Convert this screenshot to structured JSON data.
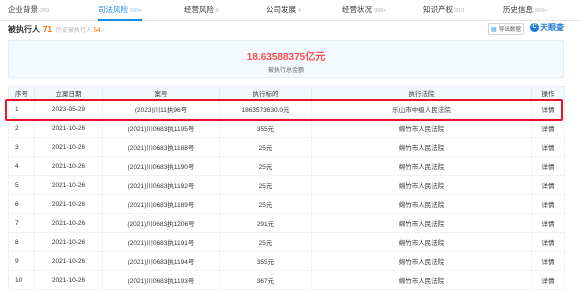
{
  "nav": {
    "tabs": [
      {
        "label": "企业背景",
        "count": "269",
        "active": false
      },
      {
        "label": "司法风险",
        "count": "999+",
        "active": true
      },
      {
        "label": "经营风险",
        "count": "6",
        "active": false
      },
      {
        "label": "公司发展",
        "count": "4",
        "active": false
      },
      {
        "label": "经营状况",
        "count": "999+",
        "active": false
      },
      {
        "label": "知识产权",
        "count": "319",
        "active": false
      },
      {
        "label": "历史信息",
        "count": "999+",
        "active": false
      }
    ]
  },
  "subbar": {
    "title": "被执行人",
    "count": "71",
    "history_label": "历史被执行人",
    "history_count": "54",
    "history_arrow": "›",
    "export_label": "导出数据",
    "logo_text": "天眼查",
    "logo_mark": "C"
  },
  "summary": {
    "amount": "18.63588375亿元",
    "label": "被执行总金额"
  },
  "table": {
    "headers": [
      "序号",
      "立案日期",
      "案号",
      "执行标的",
      "执行法院",
      "操作"
    ],
    "rows": [
      {
        "no": "1",
        "date": "2023-05-29",
        "case": "(2023)川11执96号",
        "amount": "1863573630.0元",
        "court": "乐山市中级人民法院",
        "action": "详情"
      },
      {
        "no": "2",
        "date": "2021-10-26",
        "case": "(2021)川0683执1195号",
        "amount": "355元",
        "court": "绵竹市人民法院",
        "action": "详情"
      },
      {
        "no": "3",
        "date": "2021-10-26",
        "case": "(2021)川0683执1188号",
        "amount": "25元",
        "court": "绵竹市人民法院",
        "action": "详情"
      },
      {
        "no": "4",
        "date": "2021-10-26",
        "case": "(2021)川0683执1190号",
        "amount": "25元",
        "court": "绵竹市人民法院",
        "action": "详情"
      },
      {
        "no": "5",
        "date": "2021-10-26",
        "case": "(2021)川0683执1192号",
        "amount": "25元",
        "court": "绵竹市人民法院",
        "action": "详情"
      },
      {
        "no": "6",
        "date": "2021-10-26",
        "case": "(2021)川0683执1189号",
        "amount": "25元",
        "court": "绵竹市人民法院",
        "action": "详情"
      },
      {
        "no": "7",
        "date": "2021-10-26",
        "case": "(2021)川0683执1206号",
        "amount": "291元",
        "court": "绵竹市人民法院",
        "action": "详情"
      },
      {
        "no": "8",
        "date": "2021-10-26",
        "case": "(2021)川0683执1191号",
        "amount": "25元",
        "court": "绵竹市人民法院",
        "action": "详情"
      },
      {
        "no": "9",
        "date": "2021-10-26",
        "case": "(2021)川0683执1194号",
        "amount": "355元",
        "court": "绵竹市人民法院",
        "action": "详情"
      },
      {
        "no": "10",
        "date": "2021-10-26",
        "case": "(2021)川0683执1193号",
        "amount": "367元",
        "court": "绵竹市人民法院",
        "action": "详情"
      }
    ]
  },
  "colors": {
    "accent": "#128bed",
    "highlight": "#e8132a",
    "amount": "#ff4a4a",
    "count": "#ff6600"
  }
}
